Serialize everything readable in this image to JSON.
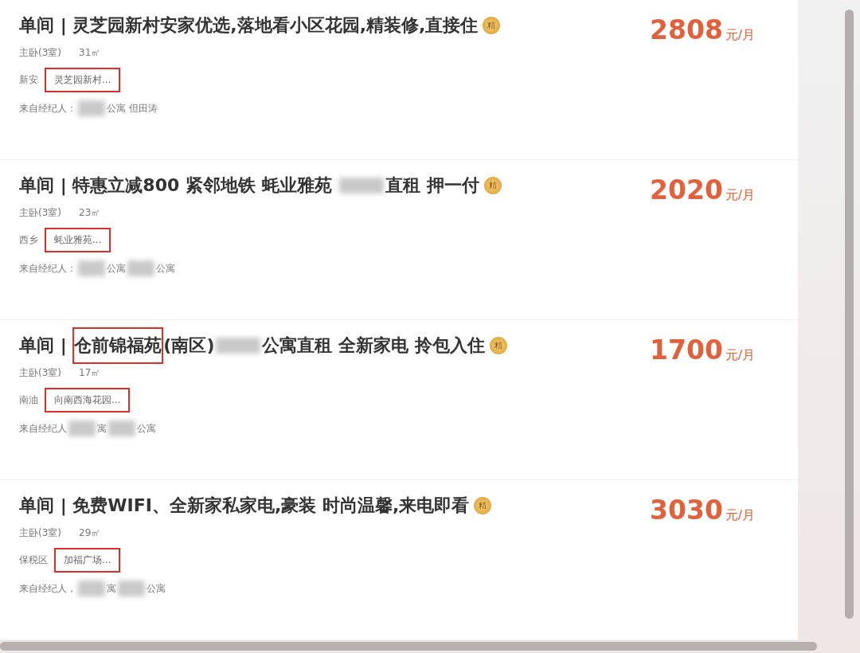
{
  "listings": [
    {
      "title": [
        {
          "kind": "text",
          "text": "单间 | 灵芝园新村安家优选,落地看小区花园,精装修,直接住"
        }
      ],
      "badge": "精",
      "room": "主卧(3室)",
      "area": "31㎡",
      "district": "新安",
      "community": "灵芝园新村...",
      "community_highlighted": true,
      "agent": [
        {
          "kind": "text",
          "text": "来自经纪人："
        },
        {
          "kind": "blur"
        },
        {
          "kind": "text",
          "text": "公寓 但田涛"
        }
      ],
      "price": "2808",
      "unit": "元/月"
    },
    {
      "title": [
        {
          "kind": "text",
          "text": "单间 | 特惠立减800 紧邻地铁 蚝业雅苑 "
        },
        {
          "kind": "blur"
        },
        {
          "kind": "text",
          "text": "直租 押一付"
        }
      ],
      "badge": "精",
      "room": "主卧(3室)",
      "area": "23㎡",
      "district": "西乡",
      "community": "蚝业雅苑...",
      "community_highlighted": true,
      "agent": [
        {
          "kind": "text",
          "text": "来自经纪人："
        },
        {
          "kind": "blur"
        },
        {
          "kind": "text",
          "text": "公寓"
        },
        {
          "kind": "blur"
        },
        {
          "kind": "text",
          "text": "公寓"
        }
      ],
      "price": "2020",
      "unit": "元/月"
    },
    {
      "title": [
        {
          "kind": "text",
          "text": "单间 | "
        },
        {
          "kind": "highlight",
          "text": "仓前锦福苑"
        },
        {
          "kind": "text",
          "text": "(南区)"
        },
        {
          "kind": "blur"
        },
        {
          "kind": "text",
          "text": "公寓直租 全新家电 拎包入住"
        }
      ],
      "badge": "精",
      "room": "主卧(3室)",
      "area": "17㎡",
      "district": "南油",
      "community": "向南西海花园...",
      "community_highlighted": true,
      "agent": [
        {
          "kind": "text",
          "text": "来自经纪人"
        },
        {
          "kind": "blur"
        },
        {
          "kind": "text",
          "text": "寓"
        },
        {
          "kind": "blur"
        },
        {
          "kind": "text",
          "text": "公寓"
        }
      ],
      "price": "1700",
      "unit": "元/月"
    },
    {
      "title": [
        {
          "kind": "text",
          "text": "单间 | 免费WIFI、全新家私家电,豪装 时尚温馨,来电即看"
        }
      ],
      "badge": "精",
      "room": "主卧(3室)",
      "area": "29㎡",
      "district": "保税区",
      "community": "加福广场...",
      "community_highlighted": true,
      "agent": [
        {
          "kind": "text",
          "text": "来自经纪人，"
        },
        {
          "kind": "blur"
        },
        {
          "kind": "text",
          "text": "寓"
        },
        {
          "kind": "blur"
        },
        {
          "kind": "text",
          "text": "公寓"
        }
      ],
      "price": "3030",
      "unit": "元/月"
    }
  ]
}
